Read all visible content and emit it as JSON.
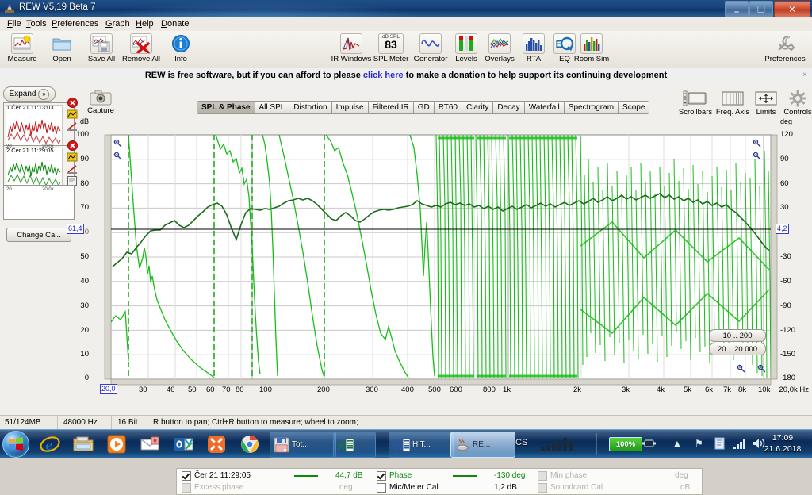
{
  "window": {
    "title": "REW V5,19 Beta 7",
    "app_icon": "rew-icon",
    "minimize_label": "–",
    "maximize_label": "❐",
    "close_label": "✕"
  },
  "menu": {
    "items": [
      {
        "label": "File",
        "mnemonic": "F"
      },
      {
        "label": "Tools",
        "mnemonic": "T"
      },
      {
        "label": "Preferences",
        "mnemonic": "P"
      },
      {
        "label": "Graph",
        "mnemonic": "G"
      },
      {
        "label": "Help",
        "mnemonic": "H"
      },
      {
        "label": "Donate",
        "mnemonic": "D"
      }
    ]
  },
  "toolbar": {
    "left": [
      {
        "label": "Measure",
        "icon": "measure-icon"
      },
      {
        "label": "Open",
        "icon": "folder-open-icon"
      },
      {
        "label": "Save All",
        "icon": "save-all-icon"
      },
      {
        "label": "Remove All",
        "icon": "remove-all-icon"
      },
      {
        "label": "Info",
        "icon": "info-icon"
      }
    ],
    "center": [
      {
        "label": "IR Windows",
        "icon": "ir-windows-icon"
      },
      {
        "label": "SPL Meter",
        "icon": "spl-meter-icon",
        "unit": "dB SPL",
        "value": "83"
      },
      {
        "label": "Generator",
        "icon": "generator-icon"
      },
      {
        "label": "Levels",
        "icon": "levels-icon"
      },
      {
        "label": "Overlays",
        "icon": "overlays-icon"
      },
      {
        "label": "RTA",
        "icon": "rta-icon"
      },
      {
        "label": "EQ",
        "icon": "eq-icon"
      },
      {
        "label": "Room Sim",
        "icon": "room-sim-icon"
      }
    ],
    "right": [
      {
        "label": "Preferences",
        "icon": "wrench-icon"
      }
    ]
  },
  "banner": {
    "text_before": "REW is free software, but if you can afford to please ",
    "link": "click here",
    "text_after": " to make a donation to help support its continuing development",
    "close": "×"
  },
  "sidebar": {
    "expand_label": "Expand",
    "expand_chevron": "»",
    "change_cal_label": "Change Cal..",
    "measurements": [
      {
        "index": "1",
        "name": "Čer 21 11:13:03",
        "color": "#c01818",
        "axis_min": "20",
        "axis_max": "20,0k"
      },
      {
        "index": "2",
        "name": "Čer 21 11:29:05",
        "color": "#0a8a0a",
        "axis_min": "20",
        "axis_max": "20,0k"
      }
    ]
  },
  "capture": {
    "label": "Capture",
    "icon": "camera-icon"
  },
  "tabs": [
    {
      "label": "SPL & Phase",
      "selected": true
    },
    {
      "label": "All SPL",
      "selected": false
    },
    {
      "label": "Distortion",
      "selected": false
    },
    {
      "label": "Impulse",
      "selected": false
    },
    {
      "label": "Filtered IR",
      "selected": false
    },
    {
      "label": "GD",
      "selected": false
    },
    {
      "label": "RT60",
      "selected": false
    },
    {
      "label": "Clarity",
      "selected": false
    },
    {
      "label": "Decay",
      "selected": false
    },
    {
      "label": "Waterfall",
      "selected": false
    },
    {
      "label": "Spectrogram",
      "selected": false
    },
    {
      "label": "Scope",
      "selected": false
    }
  ],
  "graph_tools": [
    {
      "label": "Scrollbars",
      "icon": "scrollbars-icon"
    },
    {
      "label": "Freq. Axis",
      "icon": "freq-axis-icon"
    },
    {
      "label": "Limits",
      "icon": "limits-icon"
    },
    {
      "label": "Controls",
      "icon": "controls-gear-icon"
    }
  ],
  "chart_data": {
    "type": "line",
    "title": "SPL & Phase",
    "xlabel": "Hz",
    "ylabel": "dB",
    "y2label": "deg",
    "xscale": "log",
    "xlim": [
      20,
      20000
    ],
    "ylim": [
      0,
      100
    ],
    "y2lim": [
      -180,
      120
    ],
    "grid": true,
    "legend_position": "bottom",
    "x_ticks": [
      "20,0",
      "30",
      "40",
      "50",
      "60",
      "70",
      "80",
      "100",
      "200",
      "300",
      "400",
      "500",
      "600",
      "800",
      "1k",
      "2k",
      "3k",
      "4k",
      "5k",
      "6k",
      "7k",
      "8k",
      "10k",
      "20,0k Hz"
    ],
    "y_ticks": [
      "100",
      "90",
      "80",
      "70",
      "60",
      "50",
      "40",
      "30",
      "20",
      "10",
      "0"
    ],
    "y2_ticks": [
      "120",
      "90",
      "60",
      "30",
      "0",
      "-30",
      "-60",
      "-90",
      "-120",
      "-150",
      "-180"
    ],
    "cursor": {
      "y_left": "61,4",
      "y_right": "4,2",
      "x_left": "20,0"
    },
    "range_buttons": [
      {
        "label": "10 .. 200"
      },
      {
        "label": "20 .. 20 000"
      }
    ],
    "series": [
      {
        "name": "Čer 21 11:29:05",
        "kind": "spl",
        "color": "#1b6b1b",
        "axis": "left",
        "x": [
          20,
          22,
          24,
          26,
          28,
          31,
          34,
          37,
          40,
          44,
          48,
          52,
          57,
          62,
          68,
          74,
          81,
          88,
          96,
          105,
          115,
          125,
          137,
          150,
          164,
          179,
          195,
          213,
          233,
          255,
          278,
          304,
          332,
          363,
          397,
          434,
          474,
          518,
          566,
          619,
          676,
          739,
          807,
          882,
          964,
          1054,
          1152,
          1259,
          1376,
          1504,
          1644,
          1796,
          1963,
          2145,
          2344,
          2562,
          2800,
          3060,
          3344,
          3654,
          3993,
          4364,
          4769,
          5211,
          5695,
          6223,
          6801,
          7432,
          8122,
          8876,
          9700,
          10600,
          11585,
          12661,
          13838,
          15123,
          16528,
          18062,
          19738
        ],
        "y": [
          46,
          47.5,
          49,
          51.5,
          51,
          53.5,
          56,
          58.5,
          60.5,
          61,
          60.8,
          62.5,
          63.5,
          64.5,
          63,
          62,
          62.8,
          64.5,
          66,
          67.5,
          69.5,
          70.5,
          71,
          70,
          66.5,
          61,
          56.5,
          62,
          67,
          68.5,
          68.2,
          68,
          68.5,
          68.2,
          68.8,
          69.5,
          70.5,
          71.5,
          72,
          72.5,
          71.8,
          72.5,
          71.5,
          70,
          68,
          66,
          64,
          62,
          61.5,
          63.5,
          65,
          63.5,
          62,
          61.5,
          62.5,
          64,
          65.5,
          66.5,
          67,
          67.5,
          67,
          67.5,
          68,
          68.5,
          69,
          69.5,
          70,
          71.5,
          70.5,
          70,
          69.5,
          70,
          69.5,
          68.5,
          67.5,
          66.5,
          64.5,
          62,
          59.5
        ],
        "legend_value": "44,7 dB"
      },
      {
        "name": "Phase",
        "kind": "phase",
        "color": "#19bd19",
        "axis": "right",
        "legend_value": "-130 deg",
        "description": "Wrapped phase, ±180° sawtooth, wrap density increases with frequency"
      }
    ]
  },
  "legend": {
    "rows": [
      [
        {
          "name": "measurement-checkbox",
          "label": "Čer 21 11:29:05",
          "checked": true,
          "enabled": true,
          "line": true,
          "value": "44,7 dB"
        },
        {
          "name": "phase-checkbox",
          "label": "Phase",
          "checked": true,
          "enabled": true,
          "line": true,
          "value": "-130 deg"
        },
        {
          "name": "min-phase-checkbox",
          "label": "Min phase",
          "checked": false,
          "enabled": false,
          "line": false,
          "value": "deg"
        }
      ],
      [
        {
          "name": "excess-phase-checkbox",
          "label": "Excess phase",
          "checked": false,
          "enabled": false,
          "line": false,
          "value": "deg"
        },
        {
          "name": "mic-meter-cal-checkbox",
          "label": "Mic/Meter Cal",
          "checked": false,
          "enabled": true,
          "line": false,
          "value": "1,2 dB"
        },
        {
          "name": "soundcard-cal-checkbox",
          "label": "Soundcard Cal",
          "checked": false,
          "enabled": false,
          "line": false,
          "value": "dB"
        }
      ]
    ]
  },
  "status_bar": {
    "memory": "51/124MB",
    "sample_rate": "48000 Hz",
    "bit_depth": "16 Bit",
    "hint": "R button to pan; Ctrl+R button to measure; wheel to zoom;"
  },
  "taskbar": {
    "start": "start-orb",
    "pinned": [
      {
        "name": "internet-explorer-icon",
        "glyph": "e"
      },
      {
        "name": "windows-explorer-icon",
        "glyph": "📁"
      },
      {
        "name": "media-player-icon",
        "glyph": "▶"
      },
      {
        "name": "sticky-notes-icon",
        "glyph": "✉"
      },
      {
        "name": "outlook-icon",
        "glyph": "O"
      },
      {
        "name": "xmind-icon",
        "glyph": "✕"
      },
      {
        "name": "chrome-icon",
        "glyph": "◉"
      }
    ],
    "windows": [
      {
        "name": "total-commander-window",
        "label": "Tot...",
        "icon": "floppy-icon",
        "active": false
      },
      {
        "name": "excel-window",
        "label": "",
        "icon": "excel-icon",
        "active": false
      },
      {
        "name": "word-window",
        "label": "HiT...",
        "icon": "word-icon",
        "active": false
      },
      {
        "name": "rew-window",
        "label": "RE...",
        "icon": "java-icon",
        "active": true
      }
    ],
    "tray": {
      "language": "CS",
      "show_hidden": "▲",
      "flag_icon": "⚑",
      "action_center_icon": "🗒",
      "network_icon": "signal",
      "volume_icon": "🔊",
      "battery": "100%",
      "time": "17:09",
      "date": "21.6.2018"
    }
  }
}
